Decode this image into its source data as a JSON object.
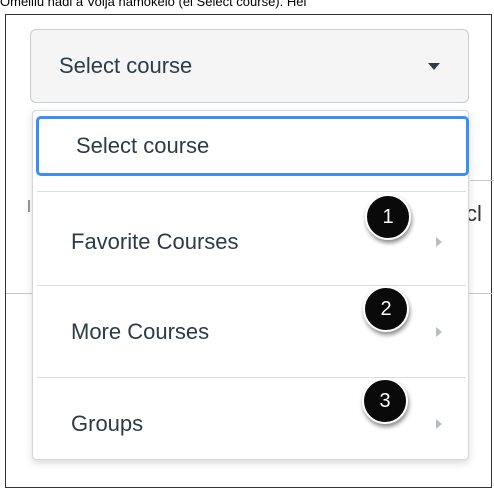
{
  "caption": "Omeiliu nadi a Voija namokelo (ei Select course). Hei",
  "select": {
    "value": "Select course"
  },
  "dropdown": {
    "search_value": "Select course",
    "items": [
      {
        "label": "Favorite Courses",
        "badge": "1"
      },
      {
        "label": "More Courses",
        "badge": "2"
      },
      {
        "label": "Groups",
        "badge": "3"
      }
    ]
  },
  "background": {
    "cut_text": "cl"
  },
  "colors": {
    "focus": "#3a8ef6",
    "badge": "#0a0a0a",
    "text": "#2d3b45"
  }
}
